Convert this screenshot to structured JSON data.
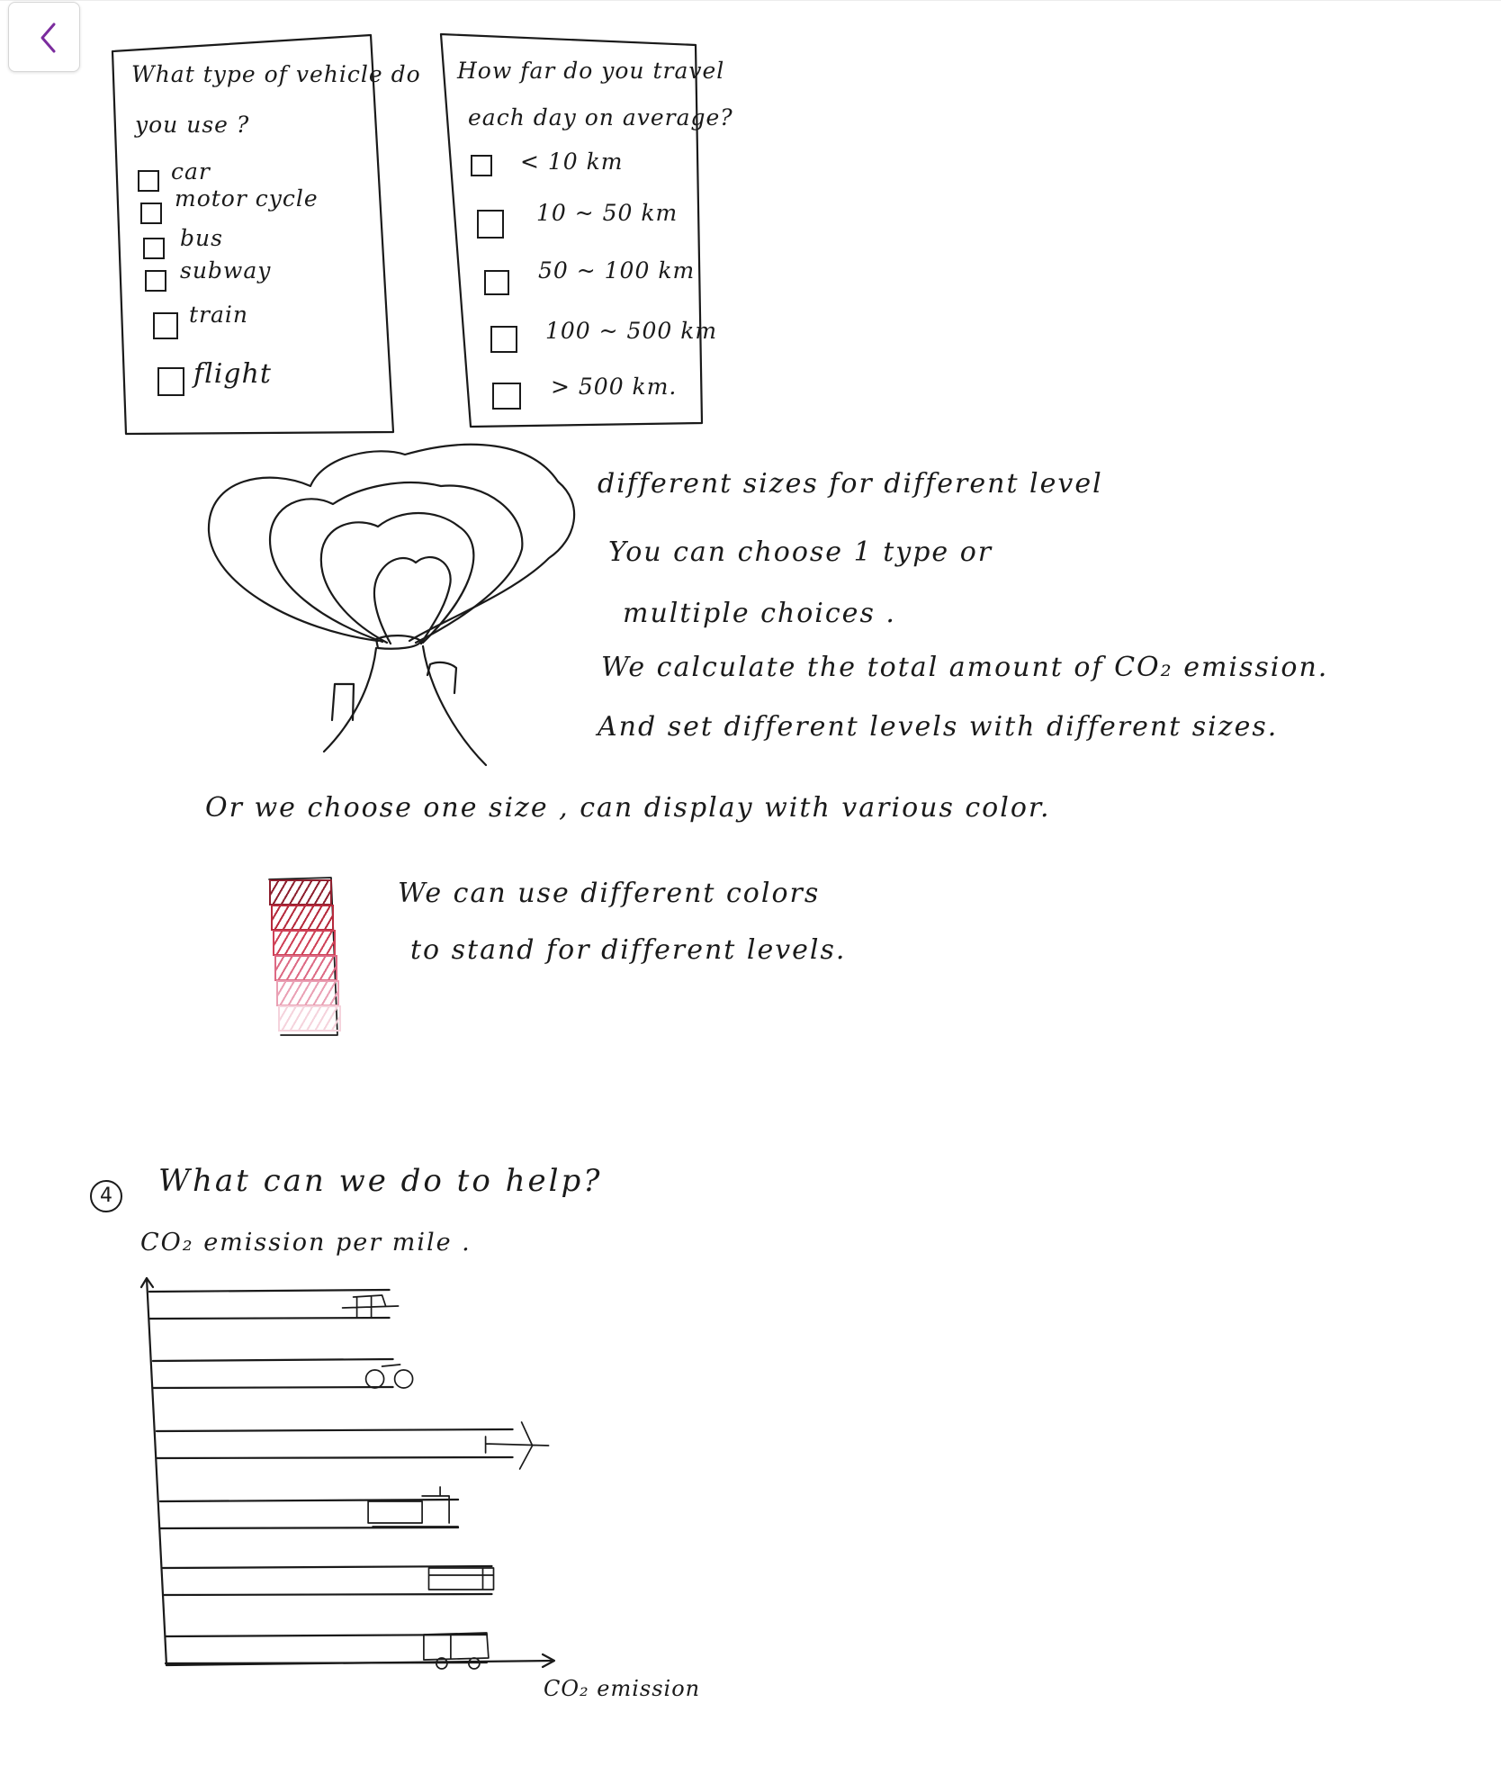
{
  "nav": {
    "back_icon": "chevron-left-icon",
    "accent": "#7b2c9e"
  },
  "survey": {
    "vehicle": {
      "question_line1": "What type of vehicle do",
      "question_line2": "you use ?",
      "options": [
        "car",
        "motor cycle",
        "bus",
        "subway",
        "train",
        "flight"
      ]
    },
    "distance": {
      "question_line1": "How far do you travel",
      "question_line2": "each day on average?",
      "options": [
        "< 10 km",
        "10 ~ 50 km",
        "50 ~ 100 km",
        "100 ~ 500 km",
        "> 500 km."
      ]
    }
  },
  "notes": {
    "line1": "different sizes for different level",
    "line2": "You can choose 1 type or",
    "line3": "multiple choices .",
    "line4": "We calculate the total amount of CO₂ emission.",
    "line5": "And set different levels with different sizes.",
    "line6": "Or we choose one size , can display with various color.",
    "line7": "We can use different colors",
    "line8": "to stand for different levels."
  },
  "color_levels": [
    "#8e1f2e",
    "#b62a3c",
    "#cf4157",
    "#dd6a84",
    "#eaa0b4",
    "#f5d3dc"
  ],
  "section4": {
    "number": "4",
    "title": "What can we do to help?",
    "subtitle": "CO₂ emission per mile ."
  },
  "chart_data": {
    "type": "bar",
    "orientation": "horizontal",
    "categories": [
      "car",
      "motorcycle",
      "flight",
      "train",
      "subway",
      "bus"
    ],
    "category_icons": [
      "car-icon",
      "motorcycle-icon",
      "airplane-icon",
      "train-icon",
      "subway-icon",
      "bus-icon"
    ],
    "values": [
      0.62,
      0.62,
      0.92,
      0.77,
      0.85,
      0.83
    ],
    "xlabel": "CO₂ emission",
    "ylabel": "",
    "title": ""
  }
}
